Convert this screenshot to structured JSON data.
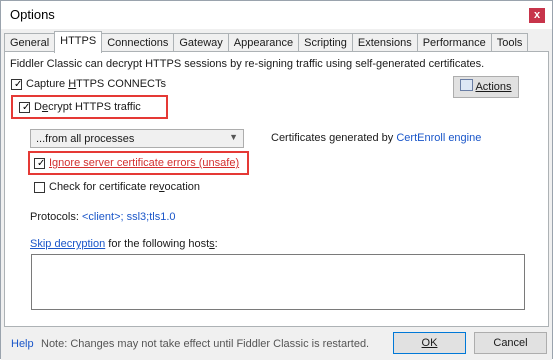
{
  "window": {
    "title": "Options",
    "close_glyph": "x"
  },
  "tabs": [
    {
      "label": "General"
    },
    {
      "label": "HTTPS",
      "active": true
    },
    {
      "label": "Connections"
    },
    {
      "label": "Gateway"
    },
    {
      "label": "Appearance"
    },
    {
      "label": "Scripting"
    },
    {
      "label": "Extensions"
    },
    {
      "label": "Performance"
    },
    {
      "label": "Tools"
    }
  ],
  "https": {
    "description": "Fiddler Classic can decrypt HTTPS sessions by re-signing traffic using self-generated certificates.",
    "actions_label": "Actions",
    "capture": {
      "pre": "Capture ",
      "u": "H",
      "post": "TTPS CONNECTs",
      "checked": true
    },
    "decrypt": {
      "pre": "D",
      "u": "e",
      "post": "crypt HTTPS traffic",
      "checked": true
    },
    "process_filter": {
      "selected": "...from all processes"
    },
    "cert_info": {
      "prefix": "Certificates generated by ",
      "engine": "CertEnroll engine"
    },
    "ignore_errors": {
      "label": "Ignore server certificate errors (unsafe)",
      "checked": true
    },
    "revocation": {
      "pre": "Check for certificate re",
      "u": "v",
      "post": "ocation",
      "checked": false
    },
    "protocols": {
      "label": "Protocols: ",
      "value": "<client>; ssl3;tls1.0"
    },
    "skip": {
      "link": "Skip decryption",
      "mid": " for the following host",
      "u": "s",
      "colon": ":",
      "hosts_value": ""
    }
  },
  "footer": {
    "help": "Help",
    "note": "Note: Changes may not take effect until Fiddler Classic is restarted.",
    "ok": "OK",
    "cancel": "Cancel"
  },
  "colors": {
    "highlight": "#e53935",
    "link": "#1a56c9",
    "warning_text": "#d32f2f"
  }
}
